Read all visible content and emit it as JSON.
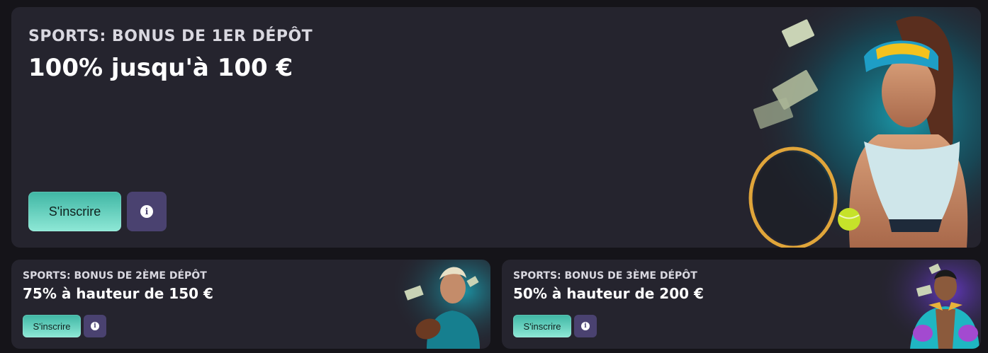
{
  "promos": {
    "main": {
      "subtitle": "SPORTS: BONUS DE 1ER DÉPÔT",
      "title": "100% jusqu'à 100 €",
      "button_label": "S'inscrire",
      "info_icon": "info-icon",
      "illustration": "tennis-player-illustration"
    },
    "second": {
      "subtitle": "SPORTS: BONUS DE 2ÈME DÉPÔT",
      "title": "75% à hauteur de 150 €",
      "button_label": "S'inscrire",
      "info_icon": "info-icon",
      "illustration": "football-player-illustration"
    },
    "third": {
      "subtitle": "SPORTS: BONUS DE 3ÈME DÉPÔT",
      "title": "50% à hauteur de 200 €",
      "button_label": "S'inscrire",
      "info_icon": "info-icon",
      "illustration": "boxer-illustration"
    }
  },
  "colors": {
    "page_background": "#151419",
    "card_background": "#25242e",
    "button_gradient_start": "#3fb6a4",
    "button_gradient_end": "#8ee8d6",
    "info_button": "#4a4270",
    "teal_glow": "#1aa6b8",
    "purple_glow": "#6a3bd0"
  }
}
